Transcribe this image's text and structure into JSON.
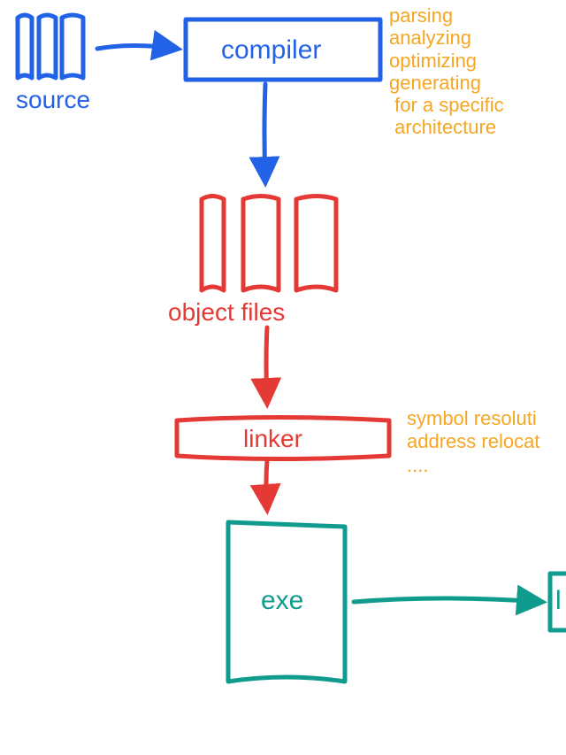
{
  "colors": {
    "blue": "#2262e6",
    "red": "#e53935",
    "green": "#0f9b8e",
    "orange": "#f5a623"
  },
  "nodes": {
    "source": {
      "label": "source"
    },
    "compiler": {
      "label": "compiler"
    },
    "compiler_notes": {
      "text": "parsing\nanalyzing\noptimizing\ngenerating\n for a specific\n architecture"
    },
    "object_files": {
      "label": "object files"
    },
    "linker": {
      "label": "linker"
    },
    "linker_notes": {
      "text": "symbol resoluti\naddress relocat\n...."
    },
    "exe": {
      "label": "exe"
    },
    "loader_partial": {
      "label": "l"
    }
  }
}
